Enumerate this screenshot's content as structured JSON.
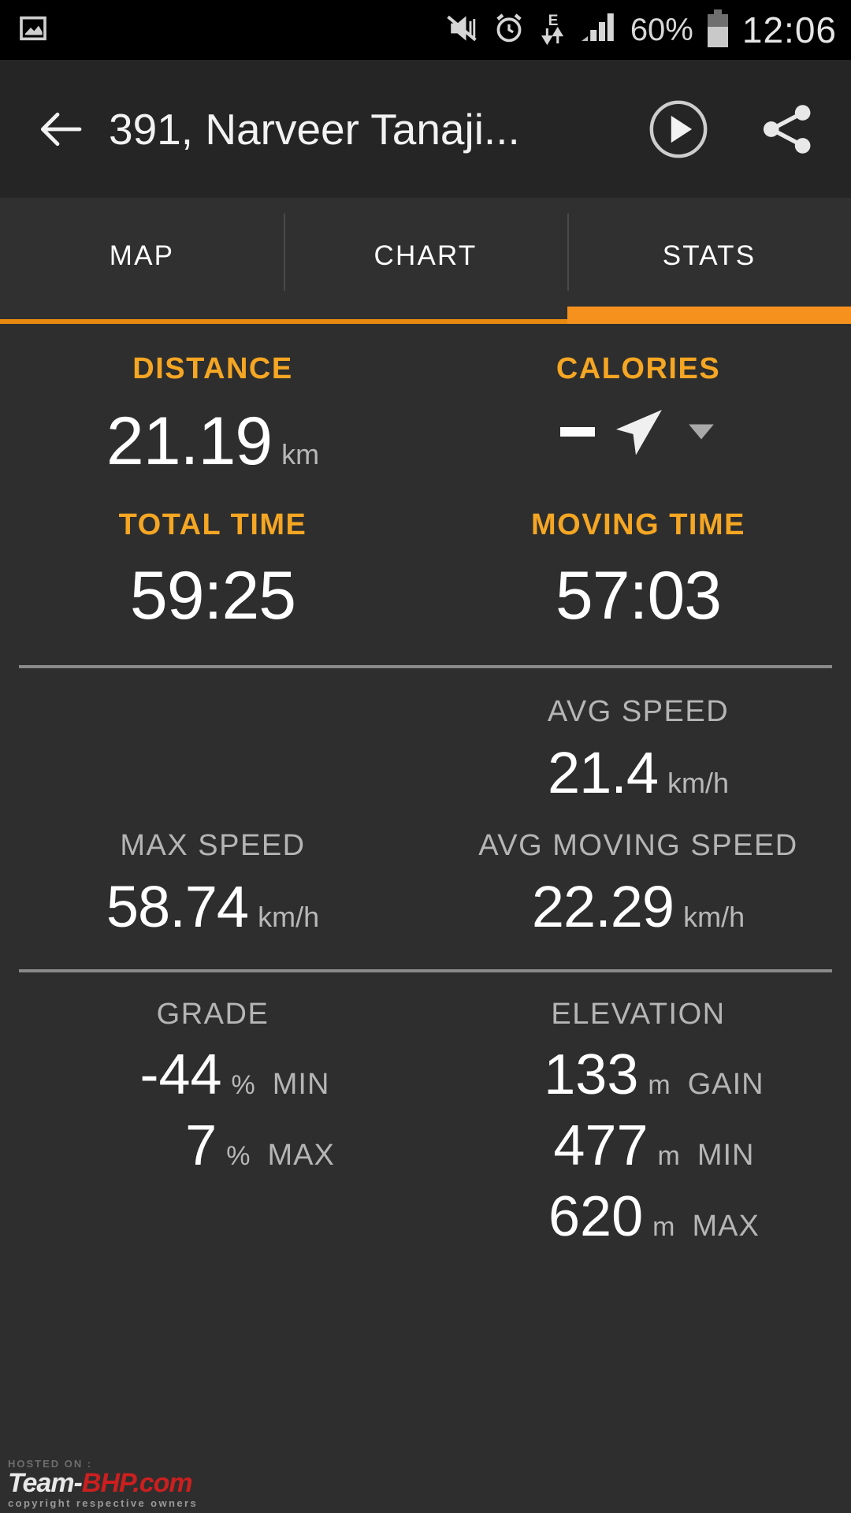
{
  "status_bar": {
    "left_icons": [
      "screenshot-icon"
    ],
    "right_icons": [
      "vibrate-off-icon",
      "alarm-icon",
      "edge-network-icon",
      "signal-icon"
    ],
    "battery_percent": "60%",
    "time": "12:06"
  },
  "app_bar": {
    "back_label": "back-arrow",
    "title": "391, Narveer Tanaji...",
    "play_label": "play",
    "share_label": "share"
  },
  "tabs": [
    {
      "label": "MAP",
      "active": false
    },
    {
      "label": "CHART",
      "active": false
    },
    {
      "label": "STATS",
      "active": true
    }
  ],
  "stats": {
    "distance": {
      "label": "DISTANCE",
      "value": "21.19",
      "unit": "km"
    },
    "calories": {
      "label": "CALORIES",
      "value": "–",
      "unit": ""
    },
    "total_time": {
      "label": "TOTAL TIME",
      "value": "59:25"
    },
    "moving_time": {
      "label": "MOVING TIME",
      "value": "57:03"
    },
    "avg_speed": {
      "label": "AVG SPEED",
      "value": "21.4",
      "unit": "km/h"
    },
    "max_speed": {
      "label": "MAX SPEED",
      "value": "58.74",
      "unit": "km/h"
    },
    "avg_moving_speed": {
      "label": "AVG MOVING SPEED",
      "value": "22.29",
      "unit": "km/h"
    },
    "grade": {
      "label": "GRADE",
      "rows": [
        {
          "value": "-44",
          "unit": "%",
          "qualifier": "MIN"
        },
        {
          "value": "7",
          "unit": "%",
          "qualifier": "MAX"
        }
      ]
    },
    "elevation": {
      "label": "ELEVATION",
      "rows": [
        {
          "value": "133",
          "unit": "m",
          "qualifier": "GAIN"
        },
        {
          "value": "477",
          "unit": "m",
          "qualifier": "MIN"
        },
        {
          "value": "620",
          "unit": "m",
          "qualifier": "MAX"
        }
      ]
    }
  },
  "watermark": {
    "top": "HOSTED ON :",
    "brand_white": "Team-",
    "brand_red": "BHP.com",
    "bottom": "copyright respective owners"
  },
  "colors": {
    "accent_orange": "#f6911e",
    "label_orange": "#f5a623",
    "background": "#2e2e2e",
    "appbar": "#252525",
    "tabbar": "#303030",
    "statusbar": "#000000",
    "label_grey": "#b5b5b5"
  }
}
